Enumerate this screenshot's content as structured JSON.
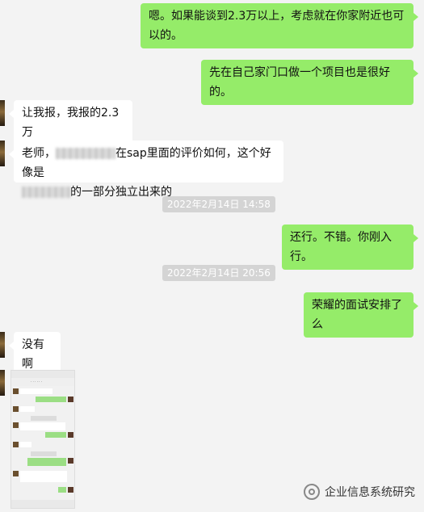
{
  "messages": [
    {
      "side": "out",
      "text": "嗯。如果能谈到2.3万以上，考虑就在你家附近也可以的。"
    },
    {
      "side": "out",
      "text": "先在自己家门口做一个项目也是很好的。"
    },
    {
      "side": "in",
      "text": "让我报，我报的2.3万"
    },
    {
      "side": "in",
      "text_a": "老师，",
      "text_b": "在sap里面的评价如何，这个好像是",
      "text_c": "的一部分独立出来的"
    },
    {
      "side": "out",
      "text": "还行。不错。你刚入行。"
    },
    {
      "side": "out",
      "text": "荣耀的面试安排了么"
    },
    {
      "side": "in",
      "text": "没有啊"
    }
  ],
  "timestamps": [
    "2022年2月14日 14:58",
    "2022年2月14日 20:56"
  ],
  "watermark": {
    "icon": "wechat-official-account-icon",
    "text": "企业信息系统研究"
  },
  "colors": {
    "outgoing": "#95ec69",
    "incoming": "#ffffff",
    "background": "#f3f3f3"
  }
}
